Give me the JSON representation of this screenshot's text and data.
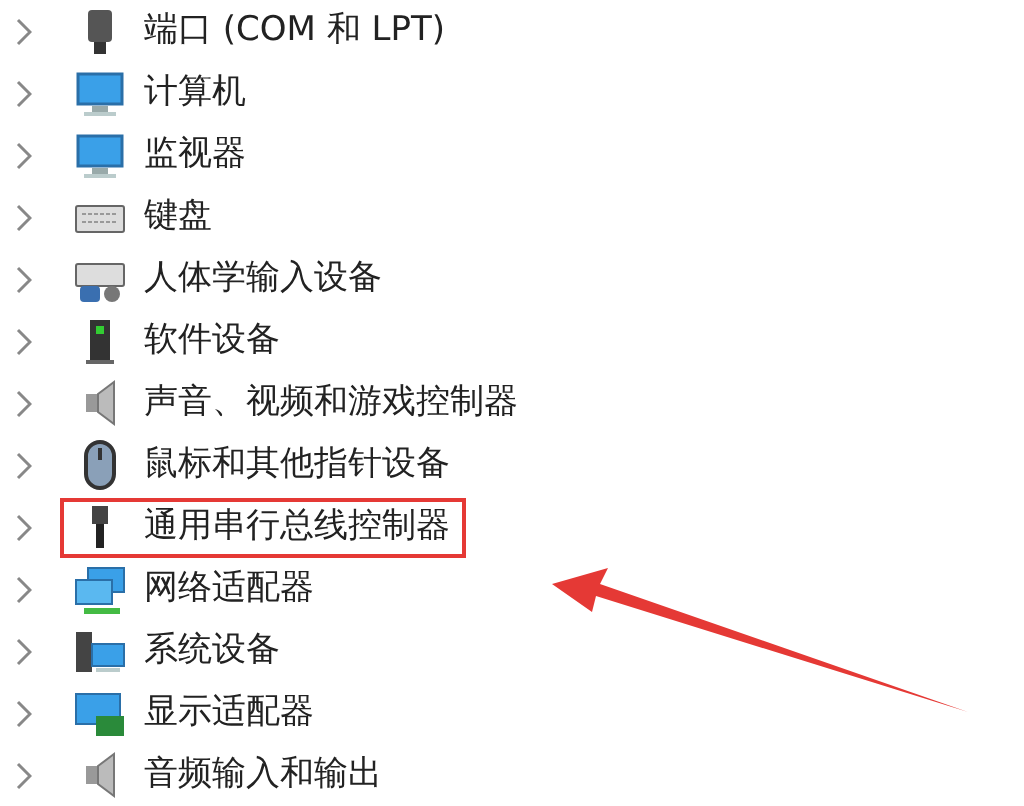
{
  "devices": [
    {
      "label": "端口 (COM 和 LPT)",
      "kind": "port",
      "highlighted": false
    },
    {
      "label": "计算机",
      "kind": "computer",
      "highlighted": false
    },
    {
      "label": "监视器",
      "kind": "monitor",
      "highlighted": false
    },
    {
      "label": "键盘",
      "kind": "keyboard",
      "highlighted": false
    },
    {
      "label": "人体学输入设备",
      "kind": "hid",
      "highlighted": false
    },
    {
      "label": "软件设备",
      "kind": "software",
      "highlighted": false
    },
    {
      "label": "声音、视频和游戏控制器",
      "kind": "sound",
      "highlighted": false
    },
    {
      "label": "鼠标和其他指针设备",
      "kind": "mouse",
      "highlighted": false
    },
    {
      "label": "通用串行总线控制器",
      "kind": "usb",
      "highlighted": true
    },
    {
      "label": "网络适配器",
      "kind": "network",
      "highlighted": false
    },
    {
      "label": "系统设备",
      "kind": "system",
      "highlighted": false
    },
    {
      "label": "显示适配器",
      "kind": "display",
      "highlighted": false
    },
    {
      "label": "音频输入和输出",
      "kind": "audio",
      "highlighted": false
    }
  ]
}
